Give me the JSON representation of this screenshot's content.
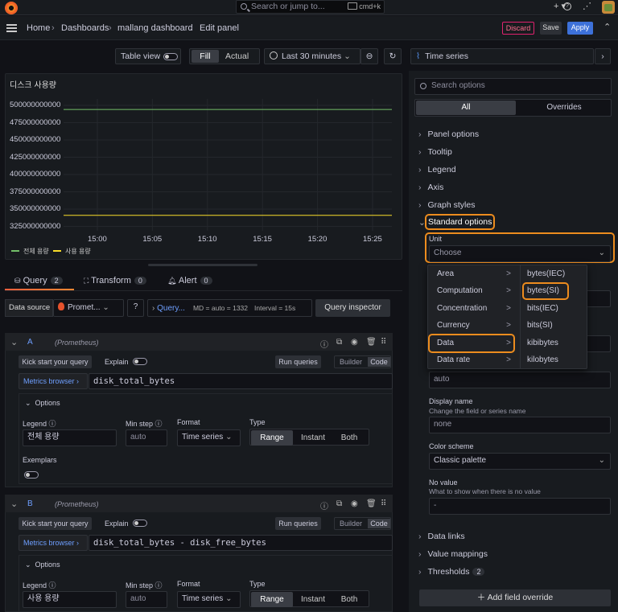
{
  "topbar": {
    "search_placeholder": "Search or jump to...",
    "shortcut": "cmd+k",
    "plus": "+"
  },
  "breadcrumbs": [
    "Home",
    "Dashboards",
    "mallang dashboard",
    "Edit panel"
  ],
  "actions": {
    "discard": "Discard",
    "save": "Save",
    "apply": "Apply"
  },
  "toolbar": {
    "table_view": "Table view",
    "fill": "Fill",
    "actual": "Actual",
    "time_range": "Last 30 minutes",
    "viz": "Time series"
  },
  "panel": {
    "title": "디스크 사용량",
    "legend": [
      "전체 용량",
      "사용 용량"
    ]
  },
  "chart_data": {
    "type": "line",
    "x": [
      "15:00",
      "15:05",
      "15:10",
      "15:15",
      "15:20",
      "15:25"
    ],
    "yticks": [
      "500000000000",
      "475000000000",
      "450000000000",
      "425000000000",
      "400000000000",
      "375000000000",
      "350000000000",
      "325000000000"
    ],
    "series": [
      {
        "name": "전체 용량",
        "color": "#73bf69",
        "value": 494000000000
      },
      {
        "name": "사용 용량",
        "color": "#fade2a",
        "value": 341000000000
      }
    ]
  },
  "tabs": {
    "query": "Query",
    "query_count": "2",
    "transform": "Transform",
    "transform_count": "0",
    "alert": "Alert",
    "alert_count": "0"
  },
  "datasource": {
    "label": "Data source",
    "name": "Promet...",
    "query_options": "Query...",
    "md": "MD = auto = 1332",
    "interval": "Interval = 15s",
    "inspector": "Query inspector"
  },
  "queries": [
    {
      "letter": "A",
      "source": "(Prometheus)",
      "kick": "Kick start your query",
      "explain": "Explain",
      "run": "Run queries",
      "builder": "Builder",
      "code": "Code",
      "metrics": "Metrics browser",
      "expr": "disk_total_bytes",
      "options": "Options",
      "legend_label": "Legend",
      "legend": "전체 용량",
      "minstep_label": "Min step",
      "minstep": "auto",
      "format_label": "Format",
      "format": "Time series",
      "type_label": "Type",
      "types": [
        "Range",
        "Instant",
        "Both"
      ],
      "exemplars": "Exemplars"
    },
    {
      "letter": "B",
      "source": "(Prometheus)",
      "kick": "Kick start your query",
      "explain": "Explain",
      "run": "Run queries",
      "builder": "Builder",
      "code": "Code",
      "metrics": "Metrics browser",
      "expr": "disk_total_bytes - disk_free_bytes",
      "options": "Options",
      "legend_label": "Legend",
      "legend": "사용 용량",
      "minstep_label": "Min step",
      "minstep": "auto",
      "format_label": "Format",
      "format": "Time series",
      "type_label": "Type",
      "types": [
        "Range",
        "Instant",
        "Both"
      ]
    }
  ],
  "options": {
    "search_placeholder": "Search options",
    "all": "All",
    "overrides": "Overrides",
    "sections": [
      "Panel options",
      "Tooltip",
      "Legend",
      "Axis",
      "Graph styles",
      "Standard options"
    ],
    "unit_label": "Unit",
    "unit_placeholder": "Choose",
    "min_value": "auto",
    "display_name": "Display name",
    "display_name_desc": "Change the field or series name",
    "display_name_placeholder": "none",
    "color_scheme": "Color scheme",
    "color_value": "Classic palette",
    "no_value": "No value",
    "no_value_desc": "What to show when there is no value",
    "no_value_placeholder": "-",
    "bottom_sections": [
      "Data links",
      "Value mappings",
      "Thresholds"
    ],
    "thresholds_count": "2",
    "add_override": "Add field override"
  },
  "unit_menu": {
    "categories": [
      "Area",
      "Computation",
      "Concentration",
      "Currency",
      "Data",
      "Data rate"
    ],
    "units": [
      "bytes(IEC)",
      "bytes(SI)",
      "bits(IEC)",
      "bits(SI)",
      "kibibytes",
      "kilobytes"
    ]
  }
}
